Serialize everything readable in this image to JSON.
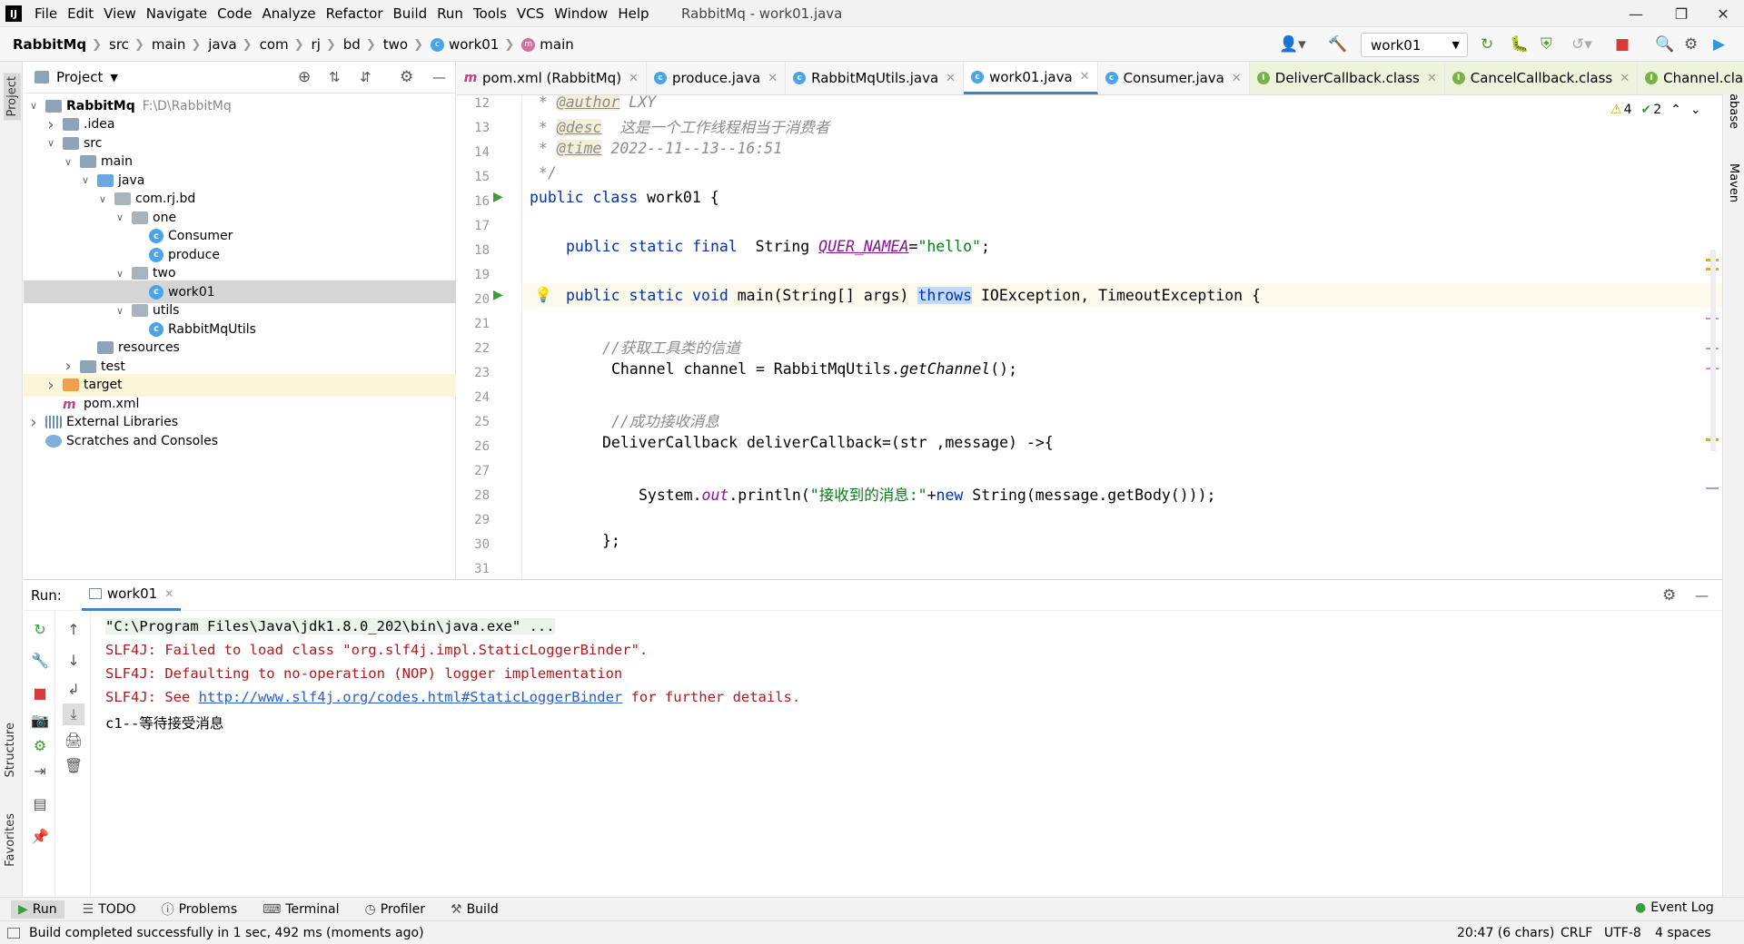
{
  "window": {
    "title": "RabbitMq - work01.java"
  },
  "menu": [
    "File",
    "Edit",
    "View",
    "Navigate",
    "Code",
    "Analyze",
    "Refactor",
    "Build",
    "Run",
    "Tools",
    "VCS",
    "Window",
    "Help"
  ],
  "breadcrumbs": [
    "RabbitMq",
    "src",
    "main",
    "java",
    "com",
    "rj",
    "bd",
    "two",
    "work01",
    "main"
  ],
  "run_config": "work01",
  "project": {
    "header": "Project",
    "tree": [
      {
        "label": "RabbitMq",
        "extra": "F:\\D\\RabbitMq",
        "depth": 0,
        "arrow": "open",
        "icon": "folder",
        "bold": true
      },
      {
        "label": ".idea",
        "depth": 1,
        "arrow": "closed",
        "icon": "folder"
      },
      {
        "label": "src",
        "depth": 1,
        "arrow": "open",
        "icon": "folder"
      },
      {
        "label": "main",
        "depth": 2,
        "arrow": "open",
        "icon": "folder"
      },
      {
        "label": "java",
        "depth": 3,
        "arrow": "open",
        "icon": "folder-src"
      },
      {
        "label": "com.rj.bd",
        "depth": 4,
        "arrow": "open",
        "icon": "folder-pkg"
      },
      {
        "label": "one",
        "depth": 5,
        "arrow": "open",
        "icon": "folder-pkg"
      },
      {
        "label": "Consumer",
        "depth": 6,
        "arrow": "none",
        "icon": "class"
      },
      {
        "label": "produce",
        "depth": 6,
        "arrow": "none",
        "icon": "class"
      },
      {
        "label": "two",
        "depth": 5,
        "arrow": "open",
        "icon": "folder-pkg"
      },
      {
        "label": "work01",
        "depth": 6,
        "arrow": "none",
        "icon": "class",
        "selected": true
      },
      {
        "label": "utils",
        "depth": 5,
        "arrow": "open",
        "icon": "folder-pkg"
      },
      {
        "label": "RabbitMqUtils",
        "depth": 6,
        "arrow": "none",
        "icon": "class"
      },
      {
        "label": "resources",
        "depth": 3,
        "arrow": "none",
        "icon": "folder"
      },
      {
        "label": "test",
        "depth": 2,
        "arrow": "closed",
        "icon": "folder"
      },
      {
        "label": "target",
        "depth": 1,
        "arrow": "closed",
        "icon": "folder-target",
        "highlight": true
      },
      {
        "label": "pom.xml",
        "depth": 1,
        "arrow": "none",
        "icon": "maven"
      },
      {
        "label": "External Libraries",
        "depth": 0,
        "arrow": "closed",
        "icon": "lib"
      },
      {
        "label": "Scratches and Consoles",
        "depth": 0,
        "arrow": "none",
        "icon": "scratch"
      }
    ]
  },
  "tabs": [
    {
      "label": "pom.xml (RabbitMq)",
      "icon": "maven"
    },
    {
      "label": "produce.java",
      "icon": "class"
    },
    {
      "label": "RabbitMqUtils.java",
      "icon": "class"
    },
    {
      "label": "work01.java",
      "icon": "class",
      "active": true
    },
    {
      "label": "Consumer.java",
      "icon": "class"
    },
    {
      "label": "DeliverCallback.class",
      "icon": "interface",
      "decompiled": true
    },
    {
      "label": "CancelCallback.class",
      "icon": "interface",
      "decompiled": true
    },
    {
      "label": "Channel.class",
      "icon": "interface",
      "decompiled": true
    }
  ],
  "inspections": {
    "warnings": "4",
    "typos": "2"
  },
  "code": {
    "line_numbers": [
      "12",
      "13",
      "14",
      "15",
      "16",
      "17",
      "18",
      "19",
      "20",
      "21",
      "22",
      "23",
      "24",
      "25",
      "26",
      "27",
      "28",
      "29",
      "30",
      "31"
    ],
    "l12_star": " * ",
    "l12_tag": "@author",
    "l12_text": " LXY",
    "l13_star": " * ",
    "l13_tag": "@desc",
    "l13_text": "  这是一个工作线程相当于消费者",
    "l14_star": " * ",
    "l14_tag": "@time",
    "l14_text": " 2022--11--13--16:51",
    "l15": " */",
    "l16_kw": "public class",
    "l16_rest": " work01 {",
    "l18_kw": "public static final",
    "l18_type": "  String ",
    "l18_const": "QUER_NAMEA",
    "l18_eq": "=",
    "l18_str": "\"hello\"",
    "l18_end": ";",
    "l20_kw": "public static void",
    "l20_mid": " main(String[] args) ",
    "l20_throws": "throws",
    "l20_rest": " IOException, TimeoutException {",
    "l22": "//获取工具类的信道",
    "l23_a": "Channel channel = RabbitMqUtils.",
    "l23_m": "getChannel",
    "l23_b": "();",
    "l25": "//成功接收消息",
    "l26": "DeliverCallback deliverCallback=(str ,message) ->{",
    "l28_a": "System.",
    "l28_out": "out",
    "l28_b": ".println(",
    "l28_str": "\"接收到的消息:\"",
    "l28_c": "+",
    "l28_new": "new",
    "l28_d": " String(message.getBody()));",
    "l30": "};"
  },
  "run": {
    "label": "Run:",
    "tab": "work01",
    "lines": [
      {
        "text": "\"C:\\Program Files\\Java\\jdk1.8.0_202\\bin\\java.exe\" ...",
        "kind": "cmd"
      },
      {
        "text": "SLF4J: Failed to load class \"org.slf4j.impl.StaticLoggerBinder\".",
        "kind": "err"
      },
      {
        "text": "SLF4J: Defaulting to no-operation (NOP) logger implementation",
        "kind": "err"
      },
      {
        "text": "c1--等待接受消息",
        "kind": "out"
      }
    ],
    "link_pre": "SLF4J: See ",
    "link": "http://www.slf4j.org/codes.html#StaticLoggerBinder",
    "link_post": " for further details."
  },
  "bottom_tools": [
    "Run",
    "TODO",
    "Problems",
    "Terminal",
    "Profiler",
    "Build"
  ],
  "event_log": "Event Log",
  "status": {
    "message": "Build completed successfully in 1 sec, 492 ms (moments ago)",
    "position": "20:47 (6 chars)",
    "line_sep": "CRLF",
    "encoding": "UTF-8",
    "indent": "4 spaces"
  },
  "side_labels": {
    "project": "Project",
    "structure": "Structure",
    "favorites": "Favorites",
    "database": "Database",
    "maven": "Maven"
  }
}
